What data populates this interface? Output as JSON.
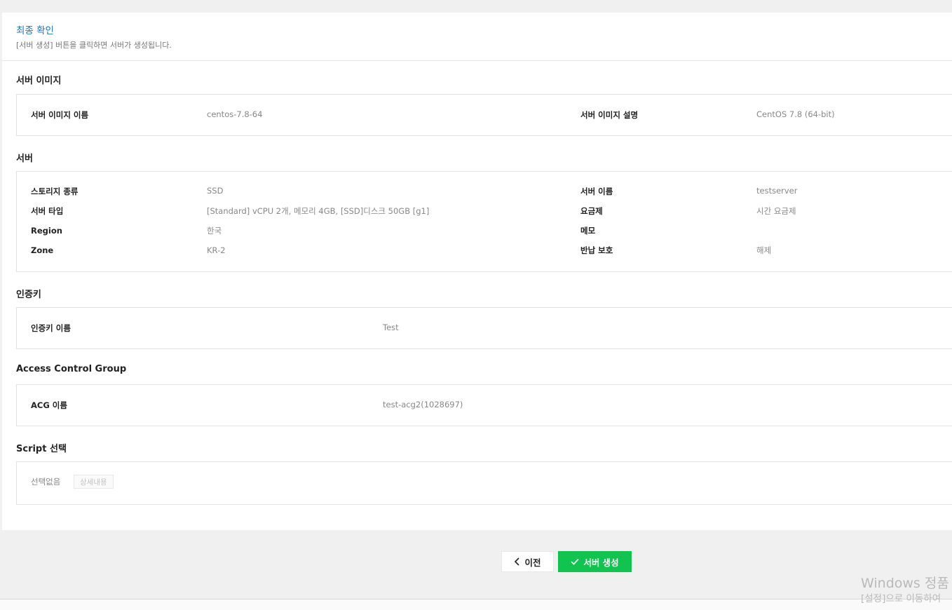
{
  "header": {
    "title": "최종 확인",
    "description": "[서버 생성] 버튼을 클릭하면 서버가 생성됩니다."
  },
  "server_image": {
    "section_title": "서버 이미지",
    "name_label": "서버 이미지 이름",
    "name_value": "centos-7.8-64",
    "desc_label": "서버 이미지 설명",
    "desc_value": "CentOS 7.8 (64-bit)"
  },
  "server": {
    "section_title": "서버",
    "storage_type_label": "스토리지 종류",
    "storage_type_value": "SSD",
    "server_type_label": "서버 타입",
    "server_type_value": "[Standard] vCPU 2개, 메모리 4GB, [SSD]디스크 50GB [g1]",
    "region_label": "Region",
    "region_value": "한국",
    "zone_label": "Zone",
    "zone_value": "KR-2",
    "server_name_label": "서버 이름",
    "server_name_value": "testserver",
    "plan_label": "요금제",
    "plan_value": "시간 요금제",
    "memo_label": "메모",
    "memo_value": "",
    "return_protection_label": "반납 보호",
    "return_protection_value": "해제"
  },
  "auth_key": {
    "section_title": "인증키",
    "name_label": "인증키 이름",
    "name_value": "Test"
  },
  "acg": {
    "section_title": "Access Control Group",
    "name_label": "ACG 이름",
    "name_value": "test-acg2(1028697)"
  },
  "script": {
    "section_title": "Script 선택",
    "selection_value": "선택없음",
    "detail_button": "상세내용"
  },
  "buttons": {
    "prev": "이전",
    "create": "서버 생성",
    "create_color": "#11c44f"
  },
  "watermark": {
    "line1": "Windows 정품",
    "line2": "[설정]으로 이동하여"
  }
}
